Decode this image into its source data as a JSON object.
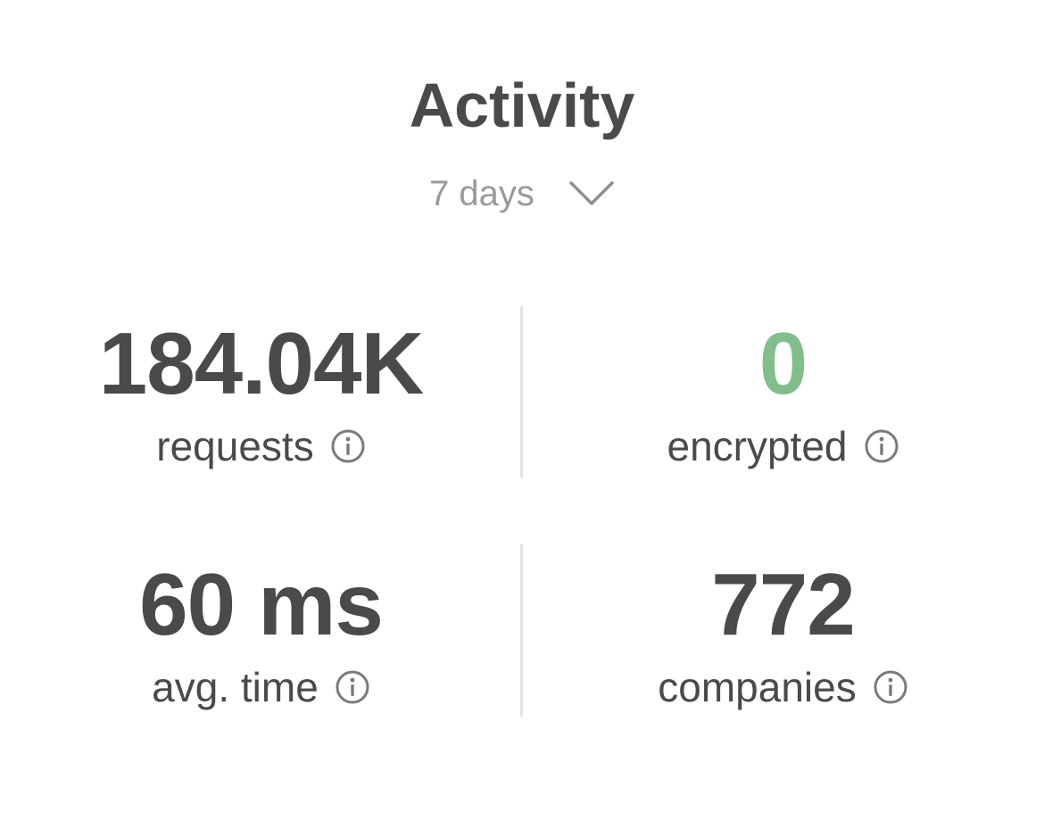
{
  "header": {
    "title": "Activity",
    "period_label": "7 days",
    "period_icon": "chevron-down-icon"
  },
  "stats": {
    "requests": {
      "value": "184.04K",
      "label": "requests",
      "icon": "info-icon"
    },
    "encrypted": {
      "value": "0",
      "label": "encrypted",
      "icon": "info-icon",
      "value_color": "#82bd8c"
    },
    "avg_time": {
      "value": "60 ms",
      "label": "avg. time",
      "icon": "info-icon"
    },
    "companies": {
      "value": "772",
      "label": "companies",
      "icon": "info-icon"
    }
  },
  "colors": {
    "text": "#4a4a4a",
    "muted": "#9a9a9a",
    "accent_green": "#82bd8c",
    "divider": "#e3e3e3"
  }
}
